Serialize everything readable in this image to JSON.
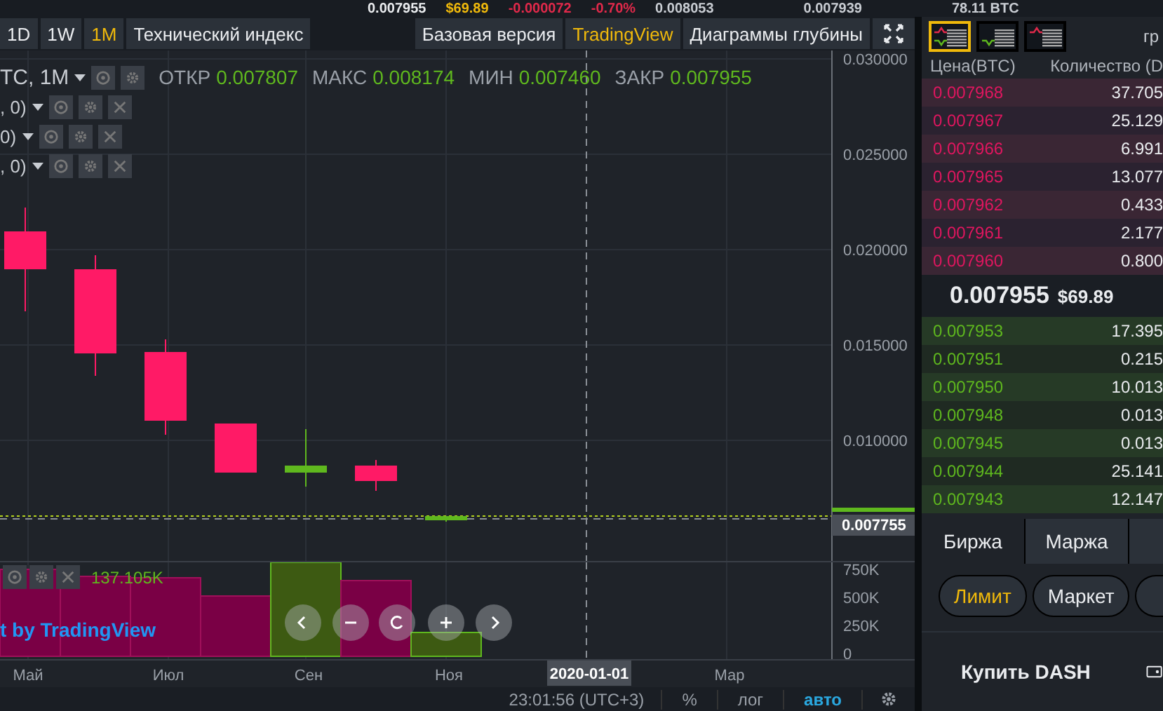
{
  "ticker": [
    {
      "kind": "price",
      "text": "0.007955"
    },
    {
      "kind": "usd",
      "text": "$69.89"
    },
    {
      "kind": "change",
      "text": "-0.000072"
    },
    {
      "kind": "change",
      "text": "-0.70%"
    },
    {
      "kind": "stat",
      "text": "0.008053"
    },
    {
      "kind": "stat",
      "text": "0.007939"
    },
    {
      "kind": "stat",
      "text": "78.11 BTC"
    }
  ],
  "toolbar": {
    "intervals": [
      {
        "label": "1D",
        "selected": false
      },
      {
        "label": "1W",
        "selected": false
      },
      {
        "label": "1M",
        "selected": true
      }
    ],
    "indicators_button": "Технический индекс",
    "views": [
      {
        "label": "Базовая версия",
        "selected": false
      },
      {
        "label": "TradingView",
        "selected": true
      },
      {
        "label": "Диаграммы глубины",
        "selected": false
      }
    ]
  },
  "chart": {
    "symbol": "TC, 1M",
    "ohlc": [
      {
        "label": "ОТКР",
        "value": "0.007807"
      },
      {
        "label": "МАКС",
        "value": "0.008174"
      },
      {
        "label": "МИН",
        "value": "0.007460"
      },
      {
        "label": "ЗАКР",
        "value": "0.007955"
      }
    ],
    "indicators": [
      ", 0)",
      "0)",
      ", 0)"
    ],
    "price_axis": [
      "0.030000",
      "0.025000",
      "0.020000",
      "0.015000",
      "0.010000"
    ],
    "last_price": "0.007755",
    "volume_value": "137.105K",
    "volume_axis": [
      "750K",
      "500K",
      "250K",
      "0"
    ],
    "attribution": "t by TradingView",
    "time_axis": [
      {
        "label": "Май",
        "selected": false
      },
      {
        "label": "Июл",
        "selected": false
      },
      {
        "label": "Сен",
        "selected": false
      },
      {
        "label": "Ноя",
        "selected": false
      },
      {
        "label": "2020-01-01",
        "selected": true
      },
      {
        "label": "Мар",
        "selected": false
      }
    ]
  },
  "bottom_bar": {
    "time": "23:01:56 (UTC+3)",
    "options": [
      {
        "label": "%",
        "selected": false
      },
      {
        "label": "лог",
        "selected": false
      },
      {
        "label": "авто",
        "selected": true
      }
    ]
  },
  "order_book": {
    "views": [
      {
        "kind": "both",
        "selected": true
      },
      {
        "kind": "bids",
        "selected": false
      },
      {
        "kind": "asks",
        "selected": false
      }
    ],
    "group_label": "гр",
    "columns": [
      "Цена(BTC)",
      "Количество (D"
    ],
    "asks": [
      {
        "price": "0.007968",
        "amount": "37.705"
      },
      {
        "price": "0.007967",
        "amount": "25.129"
      },
      {
        "price": "0.007966",
        "amount": "6.991"
      },
      {
        "price": "0.007965",
        "amount": "13.077"
      },
      {
        "price": "0.007962",
        "amount": "0.433"
      },
      {
        "price": "0.007961",
        "amount": "2.177"
      },
      {
        "price": "0.007960",
        "amount": "0.800"
      }
    ],
    "last_price": "0.007955",
    "last_usd": "$69.89",
    "bids": [
      {
        "price": "0.007953",
        "amount": "17.395"
      },
      {
        "price": "0.007951",
        "amount": "0.215"
      },
      {
        "price": "0.007950",
        "amount": "10.013"
      },
      {
        "price": "0.007948",
        "amount": "0.013"
      },
      {
        "price": "0.007945",
        "amount": "0.013"
      },
      {
        "price": "0.007944",
        "amount": "25.141"
      },
      {
        "price": "0.007943",
        "amount": "12.147"
      }
    ]
  },
  "trade": {
    "tabs": [
      {
        "label": "Биржа",
        "selected": true
      },
      {
        "label": "Маржа",
        "selected": false
      }
    ],
    "order_types": [
      {
        "label": "Лимит",
        "selected": true
      },
      {
        "label": "Маркет",
        "selected": false
      }
    ],
    "form_title": "Купить DASH"
  }
}
